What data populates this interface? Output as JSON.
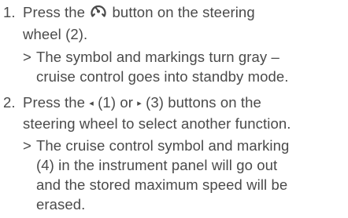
{
  "steps": [
    {
      "number": "1.",
      "line1_a": "Press the",
      "icon": "cruise-control-icon",
      "line1_b": "button on the steering",
      "line2": "wheel (2).",
      "result_marker": ">",
      "result_line1": "The symbol and markings turn gray –",
      "result_line2": "cruise control goes into standby mode."
    },
    {
      "number": "2.",
      "line1_a": "Press the",
      "left_arrow": "◂",
      "line1_b": "(1) or",
      "right_arrow": "▸",
      "line1_c": "(3) buttons on the",
      "line2": "steering wheel to select another function.",
      "result_marker": ">",
      "result_line1": "The cruise control symbol and marking",
      "result_line2": "(4) in the instrument panel will go out",
      "result_line3": "and the stored maximum speed will be",
      "result_line4": "erased."
    }
  ],
  "colors": {
    "text": "#4a4a4a",
    "background": "#ffffff"
  }
}
